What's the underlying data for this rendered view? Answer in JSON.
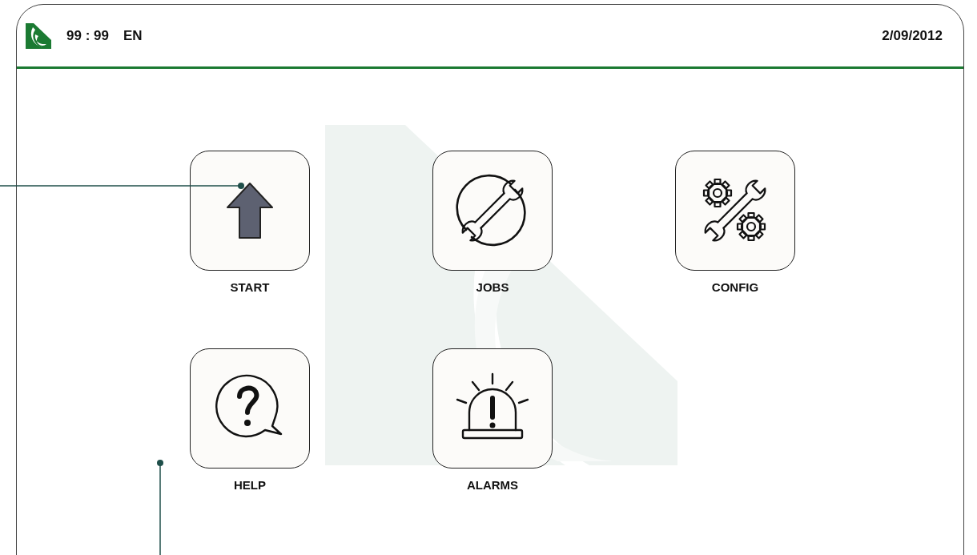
{
  "header": {
    "time": "99 : 99",
    "language": "EN",
    "date": "2/09/2012"
  },
  "tiles": [
    {
      "label": "START",
      "kind": "start"
    },
    {
      "label": "JOBS",
      "kind": "jobs"
    },
    {
      "label": "CONFIG",
      "kind": "config"
    },
    {
      "label": "HELP",
      "kind": "help"
    },
    {
      "label": "ALARMS",
      "kind": "alarms"
    }
  ]
}
